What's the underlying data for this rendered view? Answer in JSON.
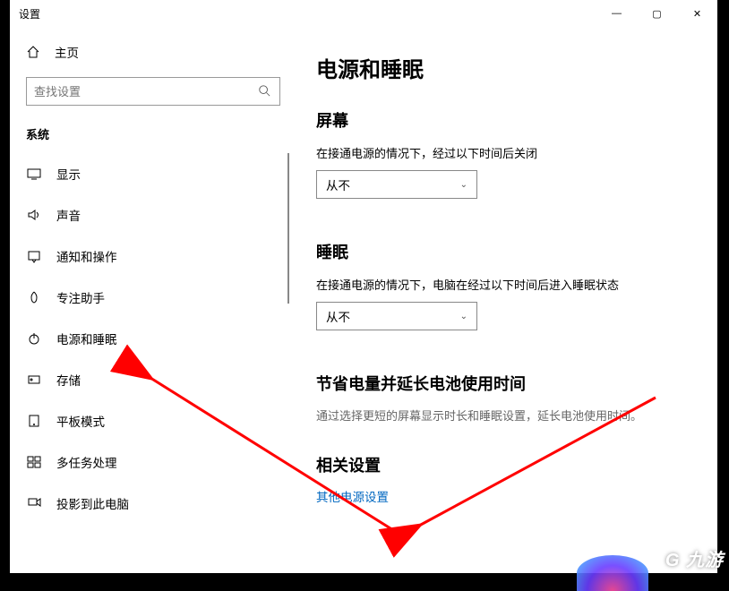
{
  "window": {
    "title": "设置"
  },
  "controls": {
    "min": "—",
    "max": "▢",
    "close": "✕"
  },
  "home": {
    "label": "主页"
  },
  "search": {
    "placeholder": "查找设置"
  },
  "section": {
    "label": "系统"
  },
  "nav": {
    "items": [
      {
        "label": "显示"
      },
      {
        "label": "声音"
      },
      {
        "label": "通知和操作"
      },
      {
        "label": "专注助手"
      },
      {
        "label": "电源和睡眠"
      },
      {
        "label": "存储"
      },
      {
        "label": "平板模式"
      },
      {
        "label": "多任务处理"
      },
      {
        "label": "投影到此电脑"
      }
    ]
  },
  "content": {
    "title": "电源和睡眠",
    "screen": {
      "heading": "屏幕",
      "label": "在接通电源的情况下，经过以下时间后关闭",
      "value": "从不"
    },
    "sleep": {
      "heading": "睡眠",
      "label": "在接通电源的情况下，电脑在经过以下时间后进入睡眠状态",
      "value": "从不"
    },
    "battery": {
      "heading": "节省电量并延长电池使用时间",
      "desc": "通过选择更短的屏幕显示时长和睡眠设置，延长电池使用时间。"
    },
    "related": {
      "heading": "相关设置",
      "link": "其他电源设置"
    }
  },
  "watermark": "G 九游"
}
